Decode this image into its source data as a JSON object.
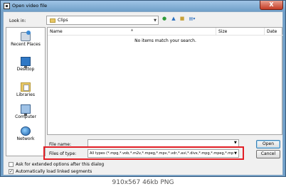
{
  "window": {
    "title": "Open video file",
    "close_glyph": "X"
  },
  "toolbar": {
    "look_in_label": "Look in:",
    "look_in_value": "Clips",
    "back_icon": "back-arrow-icon",
    "up_icon": "up-folder-icon",
    "new_folder_icon": "new-folder-icon",
    "views_icon": "views-menu-icon"
  },
  "places": [
    {
      "label": "Recent Places",
      "icon": "recent-places-icon"
    },
    {
      "label": "Desktop",
      "icon": "desktop-icon"
    },
    {
      "label": "Libraries",
      "icon": "libraries-icon"
    },
    {
      "label": "Computer",
      "icon": "computer-icon"
    },
    {
      "label": "Network",
      "icon": "network-icon"
    }
  ],
  "file_list": {
    "columns": [
      "Name",
      "Size",
      "Date"
    ],
    "empty_message": "No items match your search."
  },
  "file_name": {
    "label": "File name:",
    "value": ""
  },
  "files_of_type": {
    "label": "Files of type:",
    "value": "All types (*.mpg,*.vob,*.m2v,*.mpeg,*.mpv,*.vdr,*.avi,*.divx,*.mpg,*.mpeg,*.mp"
  },
  "buttons": {
    "open": "Open",
    "cancel": "Cancel"
  },
  "options": [
    {
      "label": "Ask for extended options after this dialog",
      "checked": false
    },
    {
      "label": "Automatically load linked segments",
      "checked": true
    }
  ],
  "footer": "910x567  46kb  PNG",
  "colors": {
    "highlight": "#e21f26",
    "title_bar": "#6f9fc8",
    "close_button": "#c43c26"
  }
}
